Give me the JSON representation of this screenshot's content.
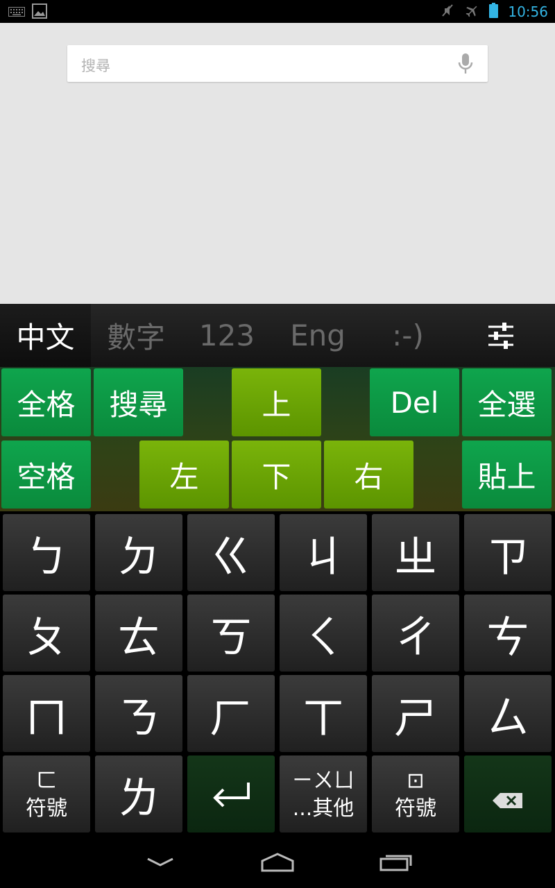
{
  "status_bar": {
    "time": "10:56",
    "icons": [
      "keyboard-icon",
      "picture-icon",
      "mute-icon",
      "airplane-icon",
      "battery-icon"
    ],
    "accent_color": "#33b5e5"
  },
  "search": {
    "placeholder": "搜尋",
    "mic_icon": "mic-icon"
  },
  "keyboard": {
    "tabs": [
      "中文",
      "數字",
      "123",
      "Eng",
      ":-)"
    ],
    "active_tab": "中文",
    "settings_icon": "sliders-icon",
    "edit_row1": [
      "全格",
      "搜尋",
      "上",
      "Del",
      "全選"
    ],
    "edit_row2": [
      "空格",
      "左",
      "下",
      "右",
      "貼上"
    ],
    "bpmf_rows": [
      [
        "ㄅ",
        "ㄉ",
        "ㄍ",
        "ㄐ",
        "ㄓ",
        "ㄗ"
      ],
      [
        "ㄆ",
        "ㄊ",
        "ㄎ",
        "ㄑ",
        "ㄔ",
        "ㄘ"
      ],
      [
        "ㄇ",
        "ㄋ",
        "ㄏ",
        "ㄒ",
        "ㄕ",
        "ㄙ"
      ]
    ],
    "bottom_row": {
      "symbols1_top": "ㄈ",
      "symbols1_label": "符號",
      "key_l": "ㄌ",
      "enter_icon": "enter-icon",
      "others_top": "ㄧㄨㄩ",
      "others_label": "...其他",
      "symbols2_top": "⊡",
      "symbols2_label": "符號",
      "backspace_icon": "backspace-icon"
    },
    "colors": {
      "green_key": "#0fa54d",
      "lime_key": "#7ab40a"
    }
  },
  "nav": {
    "icons": [
      "back-down-icon",
      "home-icon",
      "recents-icon"
    ]
  }
}
